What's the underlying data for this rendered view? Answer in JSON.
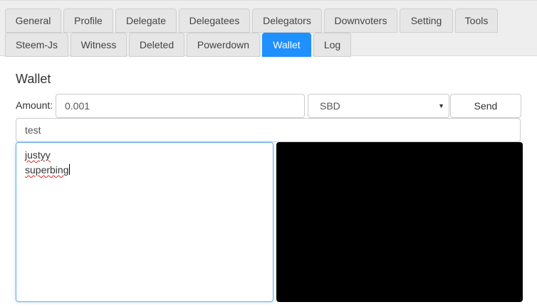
{
  "tabs_row1": [
    {
      "label": "General"
    },
    {
      "label": "Profile"
    },
    {
      "label": "Delegate"
    },
    {
      "label": "Delegatees"
    },
    {
      "label": "Delegators"
    },
    {
      "label": "Downvoters"
    },
    {
      "label": "Setting"
    },
    {
      "label": "Tools"
    }
  ],
  "tabs_row2": [
    {
      "label": "Steem-Js"
    },
    {
      "label": "Witness"
    },
    {
      "label": "Deleted"
    },
    {
      "label": "Powerdown"
    },
    {
      "label": "Wallet",
      "active": true
    },
    {
      "label": "Log"
    }
  ],
  "wallet": {
    "title": "Wallet",
    "amount_label": "Amount:",
    "amount_value": "0.001",
    "currency": "SBD",
    "send_label": "Send",
    "memo_value": "test",
    "recipients": [
      "justyy",
      "superbing"
    ]
  },
  "colors": {
    "active_tab": "#1e90ff",
    "output_bg": "#000000",
    "focus_border": "#66afe9"
  },
  "icons": {
    "select_caret": "caret-down-icon"
  }
}
